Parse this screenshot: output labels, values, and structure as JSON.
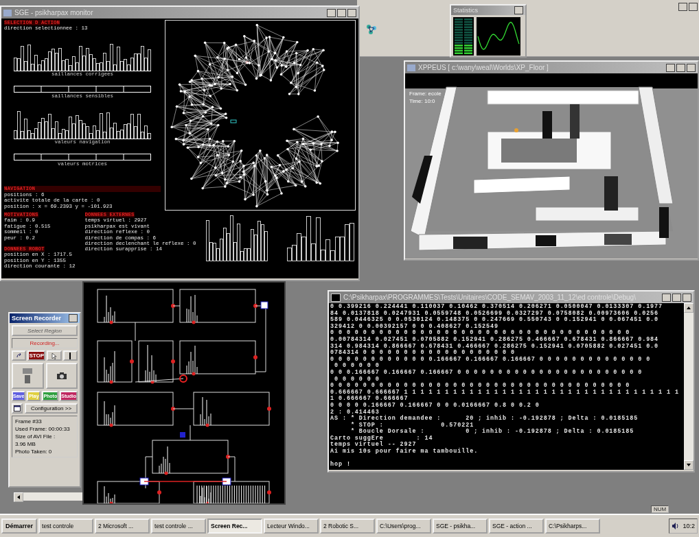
{
  "monitor_window": {
    "title": "SGE - psikharpax monitor",
    "selection": {
      "heading": "SELECTION D ACTION",
      "line": "direction selectionnee : 13",
      "chart_captions": [
        "saillances corrigees",
        "saillances sensibles",
        "valeurs navigation",
        "valeurs motrices"
      ]
    },
    "navigation": {
      "heading": "NAVIGATION",
      "lines": [
        "positions : 6",
        "activite totale de la carte : 0",
        "position : x = 69.2393 y = -101.923"
      ]
    },
    "motivation": {
      "heading": "MOTIVATIONS",
      "lines": [
        "faim : 0.9",
        "fatigue : 0.515",
        "sommeil : 0",
        "peur : 0.2"
      ]
    },
    "external": {
      "heading": "DONNEES EXTERNES",
      "lines": [
        "temps virtuel : 2927",
        "psikharpax est vivant",
        "direction reflexe : 0",
        "direction de compas : 6",
        "direction declenchant le reflexe : 0",
        "direction surapprise : 14"
      ]
    },
    "robot": {
      "heading": "DONNEES ROBOT",
      "lines": [
        "position en X : 1717.5",
        "position en Y : 1355",
        "direction courante : 12"
      ]
    }
  },
  "statistics_window": {
    "title": "Statistics"
  },
  "simulator_window": {
    "title": "XPPEUS [ c:\\wany\\weal\\Worlds\\XP_Floor ]",
    "overlay": [
      "Frame: ecole",
      "Time: 10:0"
    ]
  },
  "console_window": {
    "title": "C:\\Psikharpax\\PROGRAMMES\\Tests\\Unitaires\\CODE_SEMAV_2003_11_12\\ed controle\\Debug\\",
    "lines": [
      "0 0.399216 0.224441 0.110037 0.10462 0.370514 0.206271 0.0500047 0.0133307 0.1977",
      "84 0.0137818 0.0247931 0.0559748 0.0526699 0.0327297 0.0758082 0.00973606 0.0256",
      "589 0.0446325 0 0.0530124 0.148375 0 0.247669 0.550743 0 0.152941 0 0.067451 0.0",
      "329412 0 0.00392157 0 0 0.408627 0.152549",
      "0 0 0 0 0 0 0 0 0 0 0 0 0 0 0 0 0 0 0 0 0 0 0 0 0 0 0 0 0 0 0 0 0 0 0 0 0",
      "0.00784314 0.027451 0.0705882 0.152941 0.286275 0.466667 0.678431 0.866667 0.984",
      "314 0.984314 0.866667 0.678431 0.466667 0.286275 0.152941 0.0705882 0.027451 0.0",
      "0784314 0 0 0 0 0 0 0 0 0 0 0 0 0 0 0 0 0 0 0",
      "0 0 0 0 0 0 0 0 0 0 0 0 0.166667 0.166667 0.166667 0 0 0 0 0 0 0 0 0 0 0 0 0 0",
      " 0 0 0 0 0 0",
      "0 0 0.166667 0.166667 0.166667 0 0 0 0 0 0 0 0 0 0 0 0 0 0 0 0 0 0 0 0 0 0 0",
      " 0 0 0 0 0 0",
      "0 0 0 0 0 0 0 0 0 0 0 0 0 0 0 0 0 0 0 0 0 0 0 0 0 0 0 0 0 0 0 0 0 0 0 0 0",
      "0.666667 0.666667 1 1 1 1 1 1 1 1 1 1 1 1 1 1 1 1 1 1 1 1 1 1 1 1 1 1 1 1 1 1 1 1 1 1",
      "1 0.666667 0.666667",
      "0 0 0 0 0.166667 0.166667 0 0 0.0166667 0.8 0 0.2 0",
      "2 : 0.414463",
      "AS : * Direction demandee :      20 ; inhib : -0.192878 ; Delta : 0.0185185",
      "     * STOP :              0.570221",
      "     * Boucle Dorsale :          0 ; inhib : -0.192878 ; Delta : 0.0185185",
      "Carto suggEre        : 14",
      "temps virtuel -- 2927",
      "Ai mis 10s pour faire ma tambouille."
    ],
    "prompt": "hop !"
  },
  "screen_recorder": {
    "title": "Screen Recorder",
    "region_button": {
      "label": "Select Region",
      "disabled": true
    },
    "status": "Recording...",
    "stop_label": "STOP",
    "color_buttons": [
      {
        "label": "Save",
        "color": "#6060e0"
      },
      {
        "label": "Play",
        "color": "#e0d040"
      },
      {
        "label": "Photo",
        "color": "#30a040"
      },
      {
        "label": "Studio",
        "color": "#c02860"
      }
    ],
    "config_label": "Configuration >>",
    "info": [
      "Frame #33",
      "Used Frame: 00:00:33",
      "Size of AVI File :",
      "3.96 MB",
      "Photo Taken: 0"
    ]
  },
  "status_indicator": "NUM",
  "taskbar": {
    "start": "Démarrer",
    "tasks": [
      {
        "label": "test controle",
        "selected": false
      },
      {
        "label": "2 Microsoft ...",
        "selected": false
      },
      {
        "label": "test controle ...",
        "selected": false
      },
      {
        "label": "Screen Rec...",
        "selected": true
      },
      {
        "label": "Lecteur Windo...",
        "selected": false
      },
      {
        "label": "2 Robotic S...",
        "selected": false
      },
      {
        "label": "C:\\Users\\prog...",
        "selected": false
      },
      {
        "label": "SGE - psikha...",
        "selected": false
      },
      {
        "label": "SGE - action ...",
        "selected": false
      },
      {
        "label": "C:\\Psikharps...",
        "selected": false
      }
    ],
    "clock": "10:2"
  }
}
